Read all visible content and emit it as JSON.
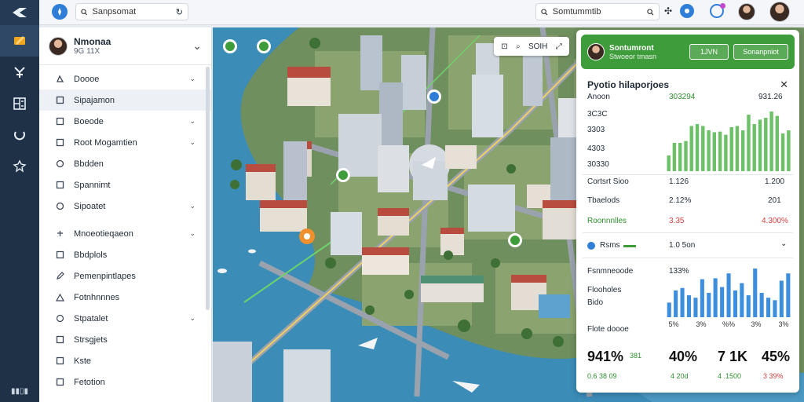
{
  "topbar": {
    "search_left_placeholder": "Sanpsomat",
    "search_right_placeholder": "Somtummtib"
  },
  "sidebar": {
    "title": "Nmonaa",
    "subtitle": "9G 11X",
    "items": [
      {
        "label": "Doooe",
        "icon": "map-pin-icon",
        "chevron": true
      },
      {
        "label": "Sipajamon",
        "icon": "square-icon",
        "chevron": false
      },
      {
        "label": "Boeode",
        "icon": "square-icon",
        "chevron": true
      },
      {
        "label": "Root Mogamtien",
        "icon": "square-icon",
        "chevron": true
      },
      {
        "label": "Bbdden",
        "icon": "circle-icon",
        "chevron": false
      },
      {
        "label": "Spannimt",
        "icon": "square-icon",
        "chevron": false
      },
      {
        "label": "Sipoatet",
        "icon": "circle-icon",
        "chevron": true
      },
      {
        "label": "Mnoeotieqaeon",
        "icon": "pin-icon",
        "chevron": true
      },
      {
        "label": "Bbdplols",
        "icon": "square-icon",
        "chevron": false
      },
      {
        "label": "Pemenpintlapes",
        "icon": "edit-icon",
        "chevron": false
      },
      {
        "label": "Fotnhnnnes",
        "icon": "triangle-icon",
        "chevron": false
      },
      {
        "label": "Stpatalet",
        "icon": "pin-icon",
        "chevron": true
      },
      {
        "label": "Strsgjets",
        "icon": "square-icon",
        "chevron": false
      },
      {
        "label": "Kste",
        "icon": "square-icon",
        "chevron": false
      },
      {
        "label": "Fetotion",
        "icon": "square-icon",
        "chevron": false
      }
    ]
  },
  "map_tools": {
    "label": "SOIH"
  },
  "panel": {
    "header_title": "Sontumront",
    "header_subtitle": "Stwoeor tmasn",
    "btn1": "1JVN",
    "btn2": "Sonanpniot",
    "title": "Pyotio hilaporjoes",
    "rows_top": [
      {
        "label": "Anoon",
        "v1": "303294",
        "v2": "931.26"
      },
      {
        "label": "3C3C",
        "v1": "",
        "v2": ""
      },
      {
        "label": "3303",
        "v1": "",
        "v2": ""
      },
      {
        "label": "4303",
        "v1": "",
        "v2": ""
      },
      {
        "label": "30330",
        "v1": "",
        "v2": ""
      }
    ],
    "chart1_values": [
      0.25,
      0.45,
      0.45,
      0.48,
      0.72,
      0.75,
      0.72,
      0.65,
      0.62,
      0.63,
      0.58,
      0.7,
      0.72,
      0.65,
      0.9,
      0.75,
      0.82,
      0.85,
      0.95,
      0.88,
      0.6,
      0.65
    ],
    "stats": [
      {
        "label": "Cortsrt Sioo",
        "v1": "1.126",
        "v2": "1.200"
      },
      {
        "label": "Tbaelods",
        "v1": "2.12%",
        "v2": "201"
      },
      {
        "label": "Roonnnlles",
        "v1": "3.35",
        "v2": "4.300%"
      }
    ],
    "toggle_label": "Rsms",
    "toggle_value": "1.0 5on",
    "section2_label": "Fsnmneoode",
    "section2_pct": "133%",
    "section2_rows": [
      "Flooholes",
      "Bido"
    ],
    "chart2_values": [
      0.3,
      0.55,
      0.6,
      0.45,
      0.4,
      0.78,
      0.5,
      0.8,
      0.62,
      0.9,
      0.55,
      0.7,
      0.45,
      1.0,
      0.5,
      0.4,
      0.35,
      0.75,
      0.9
    ],
    "chart2_ticks": [
      "5%",
      "3%",
      "%%",
      "3%",
      "3%"
    ],
    "footer_label": "Flote doooe",
    "kpis": [
      {
        "big": "941%",
        "tag": "381",
        "sub": "0.6 38 09"
      },
      {
        "big": "40%",
        "tag": "",
        "sub": "4 20d"
      },
      {
        "big": "7 1K",
        "tag": "",
        "sub": "4 .1500"
      },
      {
        "big": "45%",
        "tag": "",
        "sub": "3 39%"
      }
    ]
  },
  "colors": {
    "accent": "#3f9c3b",
    "rail": "#1e3147",
    "bar_green": "#6cc067",
    "bar_blue": "#3e8ede",
    "water": "#3c8cb8"
  }
}
